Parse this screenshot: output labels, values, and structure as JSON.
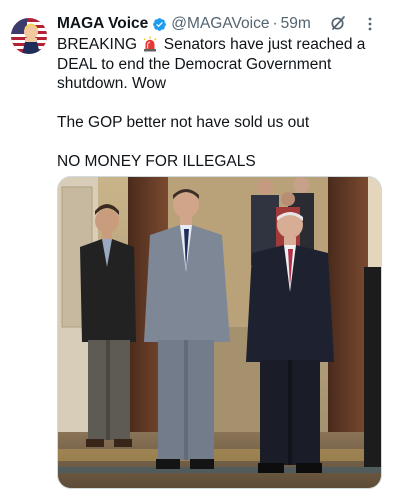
{
  "author": {
    "display_name": "MAGA Voice",
    "handle": "@MAGAVoice",
    "separator": "·",
    "timestamp": "59m"
  },
  "post": {
    "line1_before": "BREAKING",
    "line1_after": "Senators have just reached a DEAL to end the Democrat Government shutdown. Wow",
    "line2": "The GOP better not have sold us out",
    "line3": "NO MONEY FOR ILLEGALS"
  },
  "icons": {
    "verified": "verified-badge-icon",
    "siren": "siren-emoji-icon",
    "grok": "grok-icon",
    "more": "more-options-icon"
  },
  "colors": {
    "verified_blue": "#1d9bf0",
    "text_primary": "#0f1419",
    "text_secondary": "#536471"
  }
}
